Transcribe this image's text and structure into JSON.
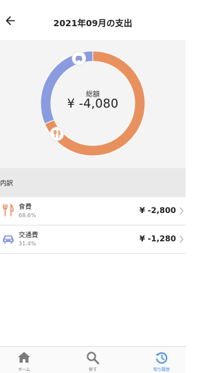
{
  "header": {
    "title": "2021年09月の支出"
  },
  "summary": {
    "label": "総額",
    "total": "¥ -4,080"
  },
  "breakdown": {
    "title": "内訳",
    "items": [
      {
        "name": "食費",
        "percent": "68.6%",
        "amount": "¥ -2,800",
        "icon": "fork-knife-icon",
        "color": "#e8915f"
      },
      {
        "name": "交通費",
        "percent": "31.4%",
        "amount": "¥ -1,280",
        "icon": "car-icon",
        "color": "#8a9bdf"
      }
    ]
  },
  "chart_data": {
    "type": "pie",
    "categories": [
      "食費",
      "交通費"
    ],
    "values": [
      68.6,
      31.4
    ],
    "colors": [
      "#e8915f",
      "#8a9bdf"
    ]
  },
  "tabs": [
    {
      "label": "ホーム",
      "icon": "home-icon",
      "active": false
    },
    {
      "label": "探す",
      "icon": "search-icon",
      "active": false
    },
    {
      "label": "取引履歴",
      "icon": "history-icon",
      "active": true
    }
  ]
}
